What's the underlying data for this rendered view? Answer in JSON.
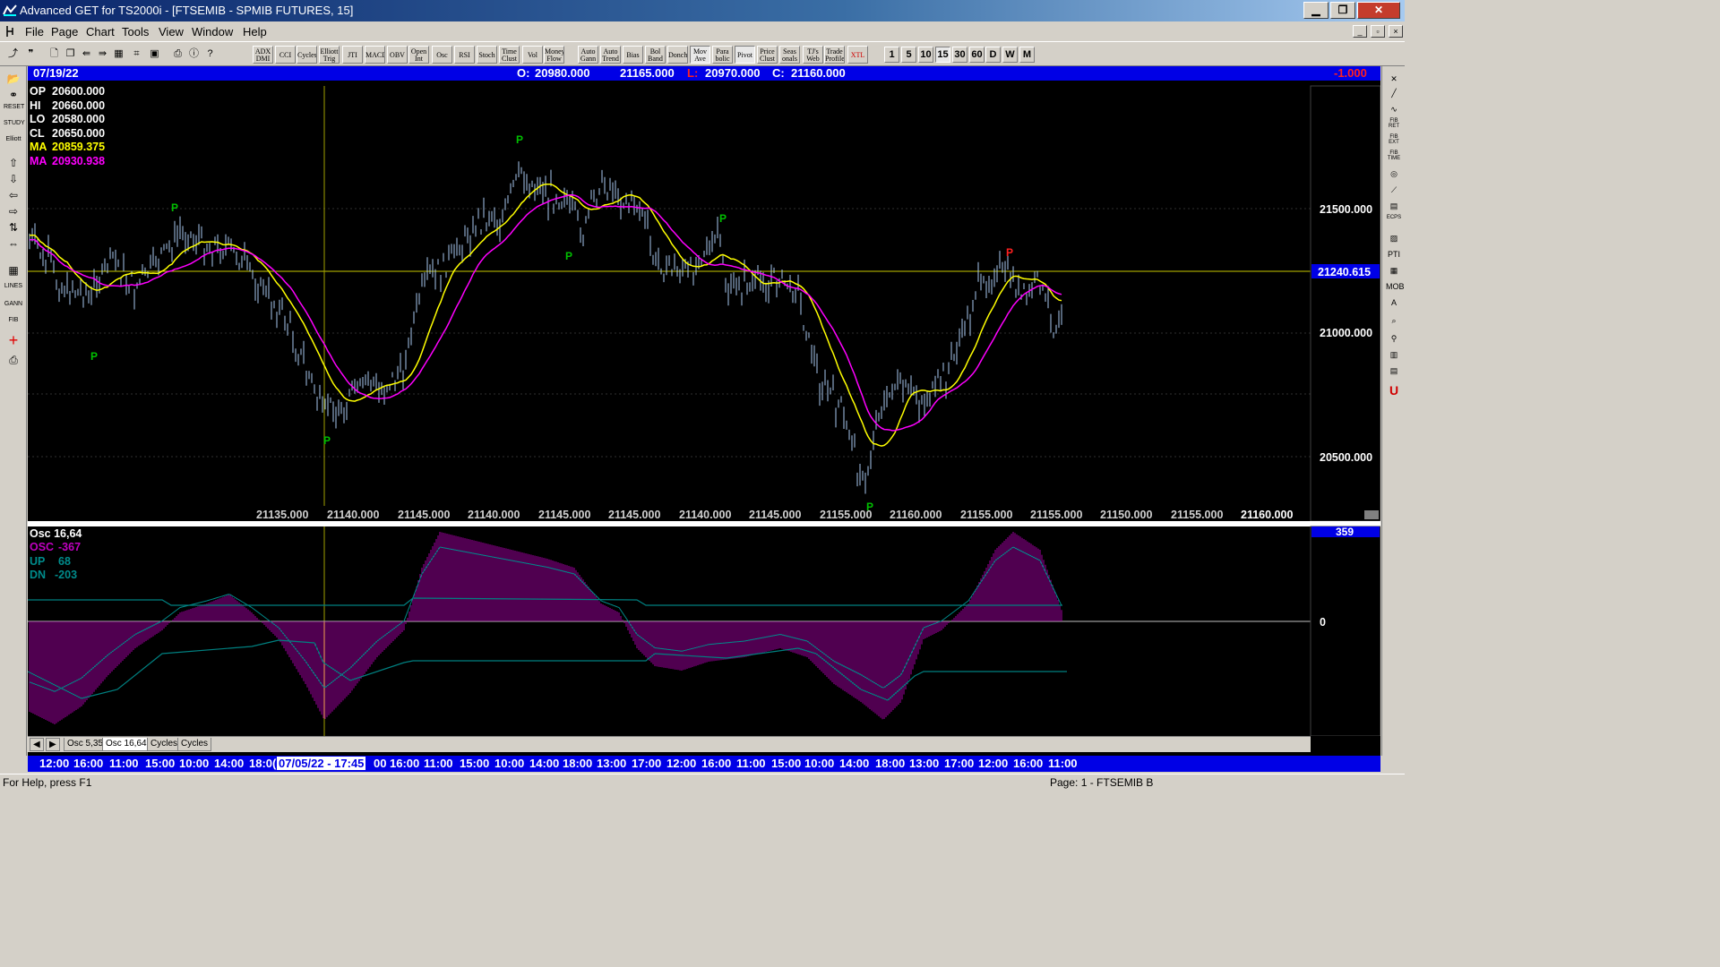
{
  "window": {
    "title": "Advanced GET for TS2000i - [FTSEMIB - SPMIB FUTURES, 15]",
    "minimize": "▁",
    "restore": "❐",
    "close": "✕"
  },
  "menu": {
    "items": [
      "File",
      "Page",
      "Chart",
      "Tools",
      "View",
      "Window",
      "Help"
    ],
    "mdi_min": "_",
    "mdi_restore": "▫",
    "mdi_close": "×"
  },
  "toolbar": {
    "studies": [
      [
        "ADX",
        "DMI"
      ],
      [
        "CCI",
        ""
      ],
      [
        "Cycles",
        ""
      ],
      [
        "Elliott",
        "Trig"
      ],
      [
        "JTI",
        ""
      ],
      [
        "MACD",
        ""
      ],
      [
        "OBV",
        ""
      ],
      [
        "Open",
        "Int"
      ],
      [
        "Osc",
        ""
      ],
      [
        "RSI",
        ""
      ],
      [
        "Stoch",
        ""
      ],
      [
        "Time",
        "Clust"
      ],
      [
        "Vol",
        ""
      ],
      [
        "Money",
        "Flow"
      ],
      [
        "Auto",
        "Gann"
      ],
      [
        "Auto",
        "Trend"
      ],
      [
        "Bias",
        ""
      ],
      [
        "Bol",
        "Band"
      ],
      [
        "Donch",
        ""
      ],
      [
        "Mov",
        "Ave"
      ],
      [
        "Para",
        "bolic"
      ],
      [
        "Pivot",
        ""
      ],
      [
        "Price",
        "Clust"
      ],
      [
        "Seas",
        "onals"
      ],
      [
        "TJ's",
        "Web"
      ],
      [
        "Trade",
        "Profile"
      ],
      [
        "XTL",
        ""
      ]
    ],
    "timeframes": [
      "1",
      "5",
      "10",
      "15",
      "30",
      "60",
      "D",
      "W",
      "M"
    ],
    "selected_timeframe": "15"
  },
  "left_tools": [
    "📂",
    "⚭",
    "RESET",
    "STUDY",
    "Elliott",
    "⇧",
    "⇩",
    "⇦",
    "⇨",
    "⇅",
    "⇔",
    "▦",
    "LINES",
    "GANN",
    "FIB",
    "+",
    "⎙"
  ],
  "right_tools": [
    "✕",
    "╱",
    "∿",
    "FIB RET",
    "FIB EXT",
    "FIB TIME",
    "◎",
    "⟋",
    "▤",
    "ECPS",
    "▨",
    "PTI",
    "▦",
    "MOB",
    "A",
    "⌕",
    "⚲",
    "▥",
    "▤",
    "U"
  ],
  "info_bar": {
    "date": "07/19/22",
    "open_label": "O:",
    "open": "20980.000",
    "high": "21165.000",
    "low_label": "L:",
    "low": "20970.000",
    "close_label": "C:",
    "close": "21160.000",
    "change": "-1.000",
    "colors": {
      "low_label": "#ff2020",
      "change": "#ff2020"
    }
  },
  "legend": {
    "op_label": "OP",
    "op": "20600.000",
    "hi_label": "HI",
    "hi": "20660.000",
    "lo_label": "LO",
    "lo": "20580.000",
    "cl_label": "CL",
    "cl": "20650.000",
    "ma1_label": "MA",
    "ma1": "20859.375",
    "ma2_label": "MA",
    "ma2": "20930.938",
    "colors": {
      "ohlc": "#ffffff",
      "ma1": "#ffff00",
      "ma2": "#ff00ff"
    }
  },
  "price_axis": {
    "ticks": [
      "21500.000",
      "21000.000",
      "20500.000"
    ],
    "current": "21240.615"
  },
  "price_row": [
    "21135.000",
    "21140.000",
    "21145.000",
    "21140.000",
    "21145.000",
    "21145.000",
    "21140.000",
    "21145.000",
    "21155.000",
    "21160.000",
    "21155.000",
    "21155.000",
    "21150.000",
    "21155.000",
    "21160.000"
  ],
  "pivots": [
    {
      "label": "P",
      "color": "#00c000"
    },
    {
      "label": "P",
      "color": "#00c000"
    },
    {
      "label": "P",
      "color": "#00c000"
    },
    {
      "label": "P",
      "color": "#00c000"
    },
    {
      "label": "P",
      "color": "#00c000"
    },
    {
      "label": "P",
      "color": "#00c000"
    },
    {
      "label": "P",
      "color": "#00c000"
    },
    {
      "label": "P",
      "color": "#ff2020"
    }
  ],
  "oscillator": {
    "title": "Osc 16,64",
    "osc_label": "OSC",
    "osc": "-367",
    "up_label": "UP",
    "up": "68",
    "dn_label": "DN",
    "dn": "-203",
    "axis_value": "359",
    "zero_label": "0",
    "colors": {
      "osc": "#c000c0",
      "bands": "#008080"
    }
  },
  "tabs": {
    "nav_left": "◀",
    "nav_right": "▶",
    "items": [
      "Osc 5,35",
      "Osc 16,64",
      "Cycles",
      "Cycles"
    ],
    "active": "Osc 16,64"
  },
  "timebar": {
    "labels": [
      "12:00",
      "16:00",
      "11:00",
      "15:00",
      "10:00",
      "14:00",
      "18:0(",
      "00",
      "16:00",
      "11:00",
      "15:00",
      "10:00",
      "14:00",
      "18:00",
      "13:00",
      "17:00",
      "12:00",
      "16:00",
      "11:00",
      "15:00",
      "10:00",
      "14:00",
      "18:00",
      "13:00",
      "17:00",
      "12:00",
      "16:00",
      "11:00"
    ],
    "cursor": "07/05/22 - 17:45"
  },
  "status": {
    "help": "For Help, press F1",
    "page": "Page: 1 - FTSEMIB B"
  }
}
